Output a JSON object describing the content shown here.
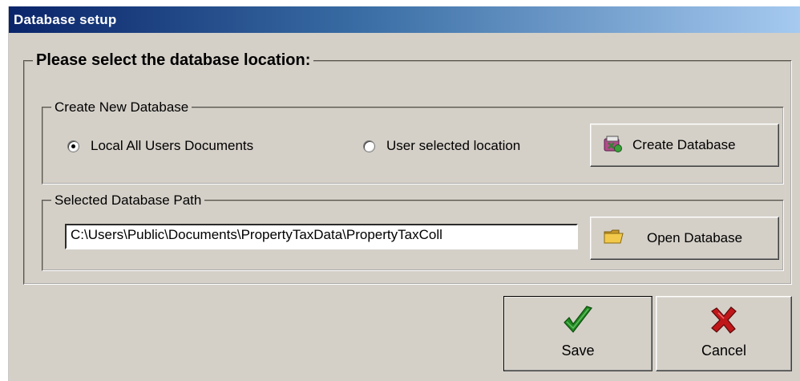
{
  "window": {
    "title": "Database setup"
  },
  "main_group": {
    "legend": "Please select the database location:"
  },
  "create_group": {
    "legend": "Create New Database",
    "radio_local_label": "Local All Users Documents",
    "radio_user_label": "User selected location",
    "radio_selected": "local",
    "create_button_label": "Create Database",
    "create_button_icon": "create-database-icon"
  },
  "path_group": {
    "legend": "Selected Database Path",
    "path_value": "C:\\Users\\Public\\Documents\\PropertyTaxData\\PropertyTaxColl",
    "open_button_label": "Open Database",
    "open_button_icon": "folder-icon"
  },
  "actions": {
    "save_label": "Save",
    "save_icon": "checkmark-icon",
    "cancel_label": "Cancel",
    "cancel_icon": "red-x-icon"
  },
  "colors": {
    "face": "#d4d0c8",
    "title_gradient_start": "#0a246a",
    "title_gradient_end": "#a6caf0",
    "save_check": "#1f8a1f",
    "cancel_x": "#c0181a"
  }
}
